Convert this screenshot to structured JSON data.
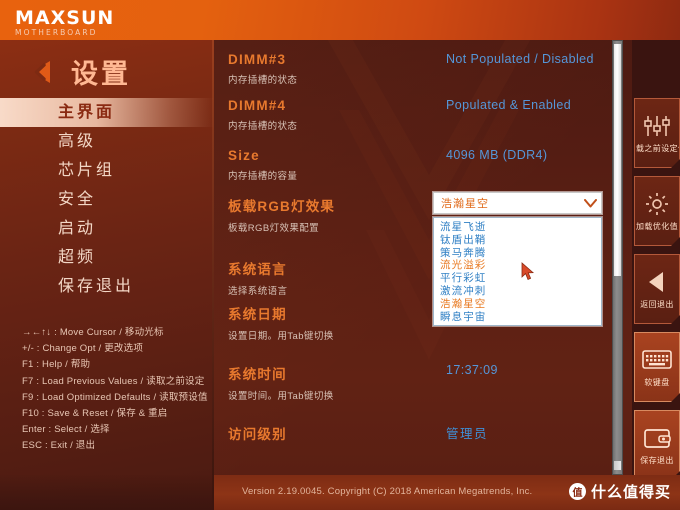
{
  "brand": {
    "name": "MAXSUN",
    "tagline": "MOTHERBOARD"
  },
  "sidebar": {
    "title": "设置",
    "back_icon": "chevron-left-icon",
    "items": [
      {
        "label": "主界面",
        "active": true
      },
      {
        "label": "高级",
        "active": false
      },
      {
        "label": "芯片组",
        "active": false
      },
      {
        "label": "安全",
        "active": false
      },
      {
        "label": "启动",
        "active": false
      },
      {
        "label": "超频",
        "active": false
      },
      {
        "label": "保存退出",
        "active": false
      }
    ],
    "help_keys": [
      "→←↑↓ : Move Cursor  /  移动光标",
      "+/- : Change Opt  /  更改选项",
      "F1 : Help  /  帮助",
      "F7 : Load Previous Values  /  读取之前设定",
      "F9 : Load Optimized Defaults  /  读取预设值",
      "F10 : Save & Reset  /  保存 & 重启",
      "Enter : Select  /  选择",
      "ESC : Exit  /  退出"
    ]
  },
  "main": {
    "rows": [
      {
        "label": "DIMM#3",
        "desc": "内存插槽的状态",
        "value": "Not Populated / Disabled",
        "cjk": false
      },
      {
        "label": "DIMM#4",
        "desc": "内存插槽的状态",
        "value": "Populated & Enabled",
        "cjk": false
      },
      {
        "label": "Size",
        "desc": "内存插槽的容量",
        "value": "4096 MB (DDR4)",
        "cjk": false
      },
      {
        "label": "板载RGB灯效果",
        "desc": "板载RGB灯效果配置",
        "value": "",
        "cjk": false
      },
      {
        "label": "系统语言",
        "desc": "选择系统语言",
        "value": "",
        "cjk": false
      },
      {
        "label": "系统日期",
        "desc": "设置日期。用Tab键切换",
        "value": "",
        "cjk": false
      },
      {
        "label": "系统时间",
        "desc": "设置时间。用Tab键切换",
        "value": "17:37:09",
        "cjk": false
      },
      {
        "label": "访问级别",
        "desc": "",
        "value": "管理员",
        "cjk": true
      }
    ],
    "rgb_select": {
      "selected": "浩瀚星空",
      "chevron_icon": "chevron-down-icon",
      "options": [
        {
          "label": "流星飞逝",
          "selected": false
        },
        {
          "label": "钛盾出鞘",
          "selected": false
        },
        {
          "label": "策马奔腾",
          "selected": false
        },
        {
          "label": "流光溢彩",
          "selected": true
        },
        {
          "label": "平行彩虹",
          "selected": false
        },
        {
          "label": "激流冲刺",
          "selected": false
        },
        {
          "label": "浩瀚星空",
          "selected": true
        },
        {
          "label": "瞬息宇宙",
          "selected": false
        }
      ]
    }
  },
  "rail": {
    "buttons": [
      {
        "label": "加载之前设定值",
        "icon": "sliders-icon",
        "lit": false
      },
      {
        "label": "加载优化值",
        "icon": "gear-icon",
        "lit": false
      },
      {
        "label": "返回退出",
        "icon": "back-triangle-icon",
        "lit": false
      },
      {
        "label": "软键盘",
        "icon": "keyboard-icon",
        "lit": true
      },
      {
        "label": "保存退出",
        "icon": "save-exit-icon",
        "lit": true
      }
    ]
  },
  "footer": {
    "version": "Version 2.19.0045. Copyright (C) 2018 American Megatrends, Inc.",
    "watermark_badge": "值",
    "watermark_text": "什么值得买"
  },
  "colors": {
    "accent_orange": "#e8620e",
    "label_orange": "#e8792e",
    "value_blue": "#5596d8",
    "panel_dark": "#5d2014"
  }
}
